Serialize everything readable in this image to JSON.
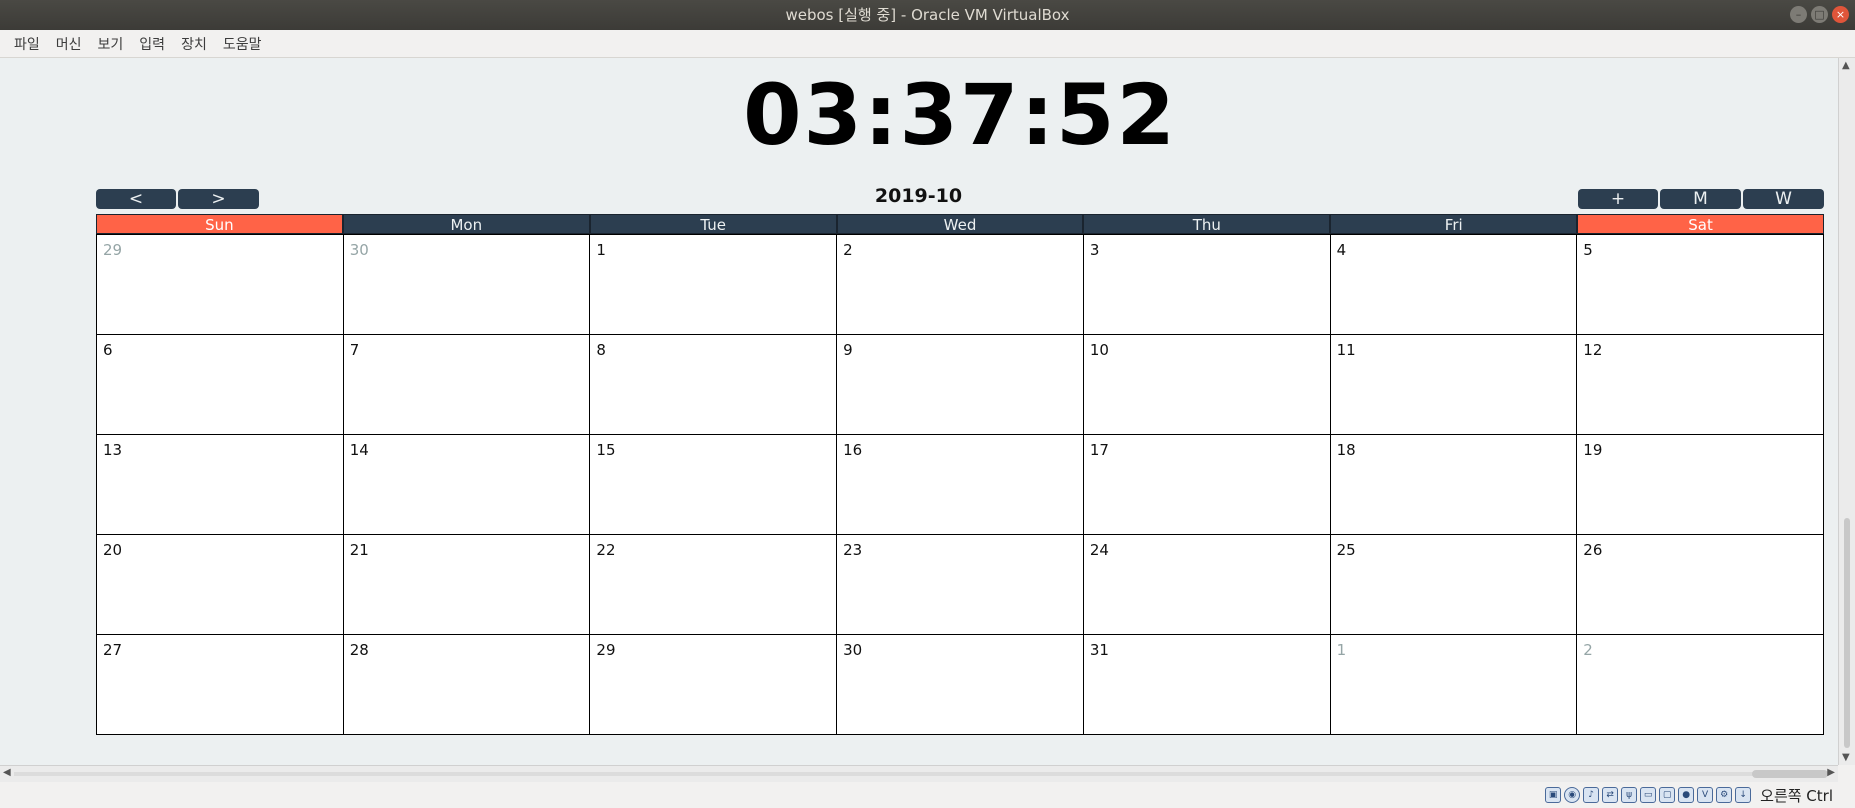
{
  "window": {
    "title": "webos [실행 중] - Oracle VM VirtualBox"
  },
  "menubar": {
    "items": [
      "파일",
      "머신",
      "보기",
      "입력",
      "장치",
      "도움말"
    ]
  },
  "clock": {
    "time": "03:37:52"
  },
  "calendar": {
    "month_label": "2019-10",
    "nav": {
      "prev_label": "<",
      "next_label": ">"
    },
    "actions": {
      "add_label": "+",
      "month_view_label": "M",
      "week_view_label": "W"
    },
    "weekday_headers": [
      "Sun",
      "Mon",
      "Tue",
      "Wed",
      "Thu",
      "Fri",
      "Sat"
    ],
    "weekend_color": "#ff6347",
    "header_color": "#2c3e50",
    "weeks": [
      [
        "29",
        "30",
        "1",
        "2",
        "3",
        "4",
        "5"
      ],
      [
        "6",
        "7",
        "8",
        "9",
        "10",
        "11",
        "12"
      ],
      [
        "13",
        "14",
        "15",
        "16",
        "17",
        "18",
        "19"
      ],
      [
        "20",
        "21",
        "22",
        "23",
        "24",
        "25",
        "26"
      ],
      [
        "27",
        "28",
        "29",
        "30",
        "31",
        "1",
        "2"
      ]
    ],
    "other_month_cells": [
      [
        0,
        0
      ],
      [
        0,
        1
      ],
      [
        4,
        5
      ],
      [
        4,
        6
      ]
    ]
  },
  "statusbar": {
    "icons": [
      "hard-disk-icon",
      "optical-drive-icon",
      "audio-icon",
      "network-icon",
      "usb-icon",
      "shared-folders-icon",
      "display-icon",
      "recording-icon",
      "vrde-icon",
      "virtualization-icon",
      "mouse-integration-icon"
    ],
    "host_key": "오른쪽 Ctrl"
  }
}
